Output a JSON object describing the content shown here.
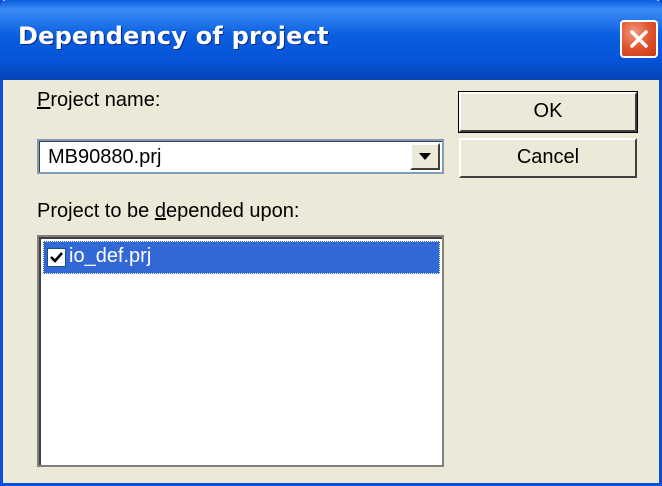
{
  "window": {
    "title": "Dependency of project"
  },
  "labels": {
    "project_name_prefix": "",
    "project_name_mnemonic": "P",
    "project_name_rest": "roject name:",
    "depended_prefix": "Project to be ",
    "depended_mnemonic": "d",
    "depended_rest": "epended upon:"
  },
  "combo": {
    "value": "MB90880.prj"
  },
  "list": {
    "items": [
      {
        "label": "io_def.prj",
        "checked": true,
        "selected": true
      }
    ]
  },
  "buttons": {
    "ok_label": "OK",
    "cancel_label": "Cancel"
  },
  "icons": {
    "close": "close-icon",
    "dropdown": "chevron-down-icon",
    "check": "checkmark-icon"
  },
  "colors": {
    "titlebar": "#0a5ee0",
    "dialog_bg": "#ece9d8",
    "selection": "#3168d5",
    "close_button": "#e0532c"
  }
}
